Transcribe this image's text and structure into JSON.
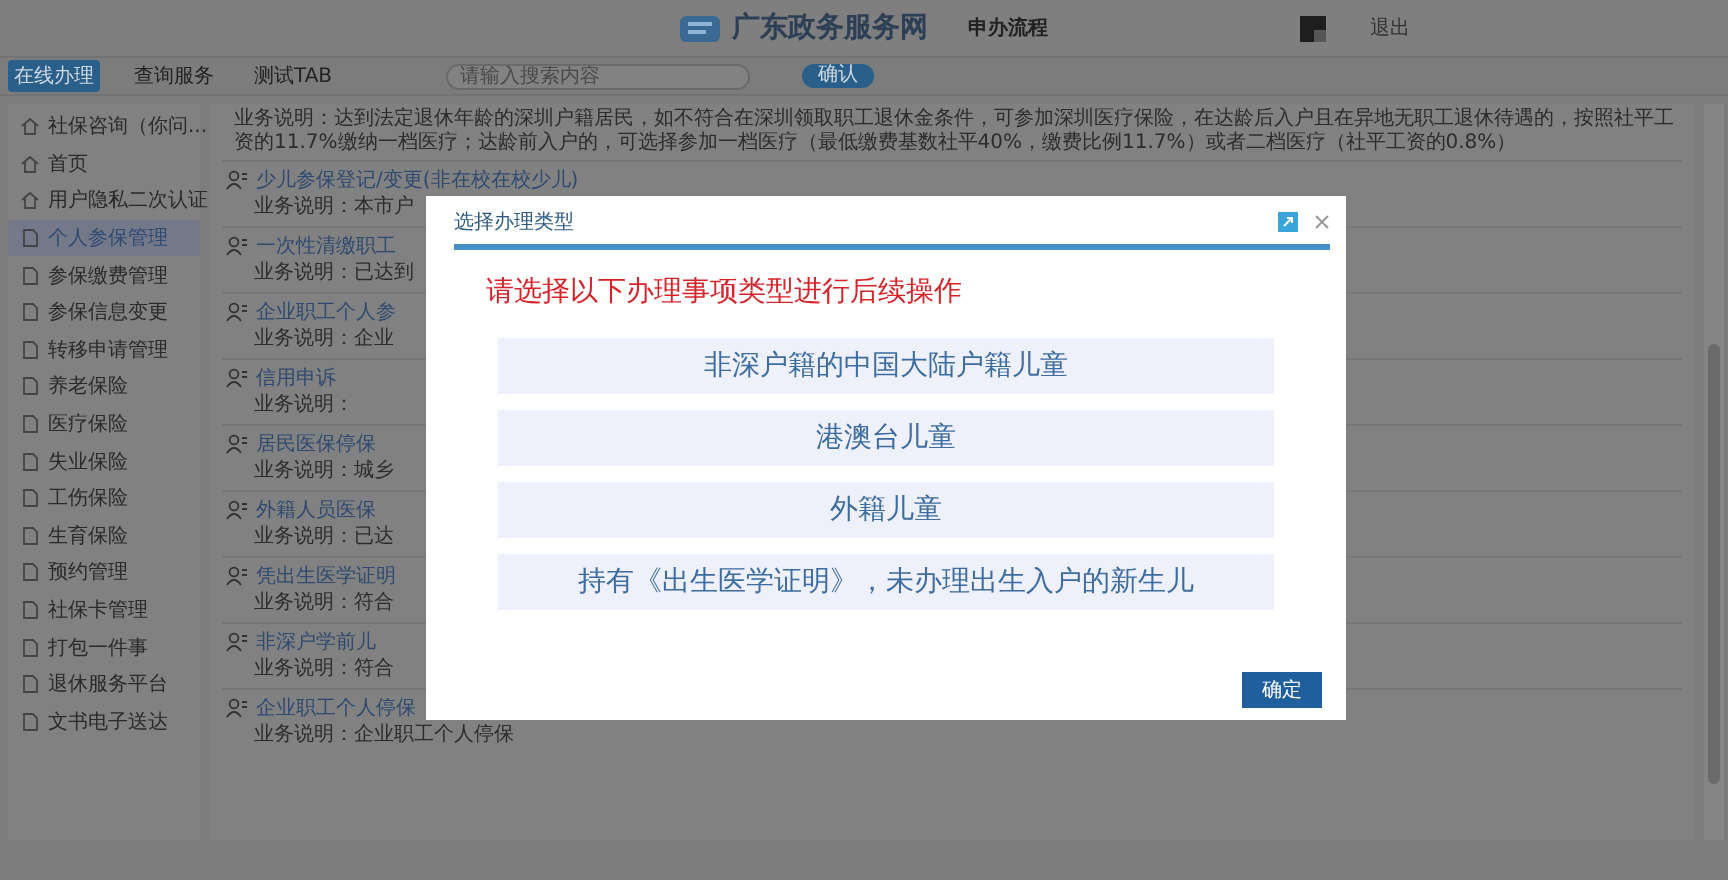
{
  "header": {
    "site_title": "广东政务服务网",
    "section": "申办流程",
    "logout": "退出"
  },
  "tabs": [
    {
      "label": "在线办理",
      "selected": true
    },
    {
      "label": "查询服务",
      "selected": false
    },
    {
      "label": "测试TAB",
      "selected": false
    }
  ],
  "search": {
    "placeholder": "请输入搜索内容",
    "button": "确认"
  },
  "sidebar": {
    "items": [
      {
        "label": "社保咨询（你问...",
        "selected": false
      },
      {
        "label": "首页",
        "selected": false
      },
      {
        "label": "用户隐私二次认证",
        "selected": false
      },
      {
        "label": "个人参保管理",
        "selected": true
      },
      {
        "label": "参保缴费管理",
        "selected": false
      },
      {
        "label": "参保信息变更",
        "selected": false
      },
      {
        "label": "转移申请管理",
        "selected": false
      },
      {
        "label": "养老保险",
        "selected": false
      },
      {
        "label": "医疗保险",
        "selected": false
      },
      {
        "label": "失业保险",
        "selected": false
      },
      {
        "label": "工伤保险",
        "selected": false
      },
      {
        "label": "生育保险",
        "selected": false
      },
      {
        "label": "预约管理",
        "selected": false
      },
      {
        "label": "社保卡管理",
        "selected": false
      },
      {
        "label": "打包一件事",
        "selected": false
      },
      {
        "label": "退休服务平台",
        "selected": false
      },
      {
        "label": "文书电子送达",
        "selected": false
      }
    ]
  },
  "services": {
    "top_description": "业务说明：达到法定退休年龄的深圳户籍居民，如不符合在深圳领取职工退休金条件，可参加深圳医疗保险，在达龄后入户且在异地无职工退休待遇的，按照社平工资的11.7%缴纳一档医疗；达龄前入户的，可选择参加一档医疗（最低缴费基数社平40%，缴费比例11.7%）或者二档医疗（社平工资的0.8%）",
    "items": [
      {
        "title": "少儿参保登记/变更(非在校在校少儿)",
        "description": "业务说明：本市户"
      },
      {
        "title": "一次性清缴职工",
        "description": "业务说明：已达到"
      },
      {
        "title": "企业职工个人参",
        "description": "业务说明：企业"
      },
      {
        "title": "信用申诉",
        "description": "业务说明："
      },
      {
        "title": "居民医保停保",
        "description": "业务说明：城乡"
      },
      {
        "title": "外籍人员医保",
        "description": "业务说明：已达"
      },
      {
        "title": "凭出生医学证明",
        "description": "业务说明：符合"
      },
      {
        "title": "非深户学前儿",
        "description": "业务说明：符合"
      },
      {
        "title": "企业职工个人停保",
        "description": "业务说明：企业职工个人停保"
      }
    ]
  },
  "dialog": {
    "title": "选择办理类型",
    "prompt": "请选择以下办理事项类型进行后续操作",
    "options": [
      "非深户籍的中国大陆户籍儿童",
      "港澳台儿童",
      "外籍儿童",
      "持有《出生医学证明》，未办理出生入户的新生儿"
    ],
    "confirm": "确定"
  }
}
